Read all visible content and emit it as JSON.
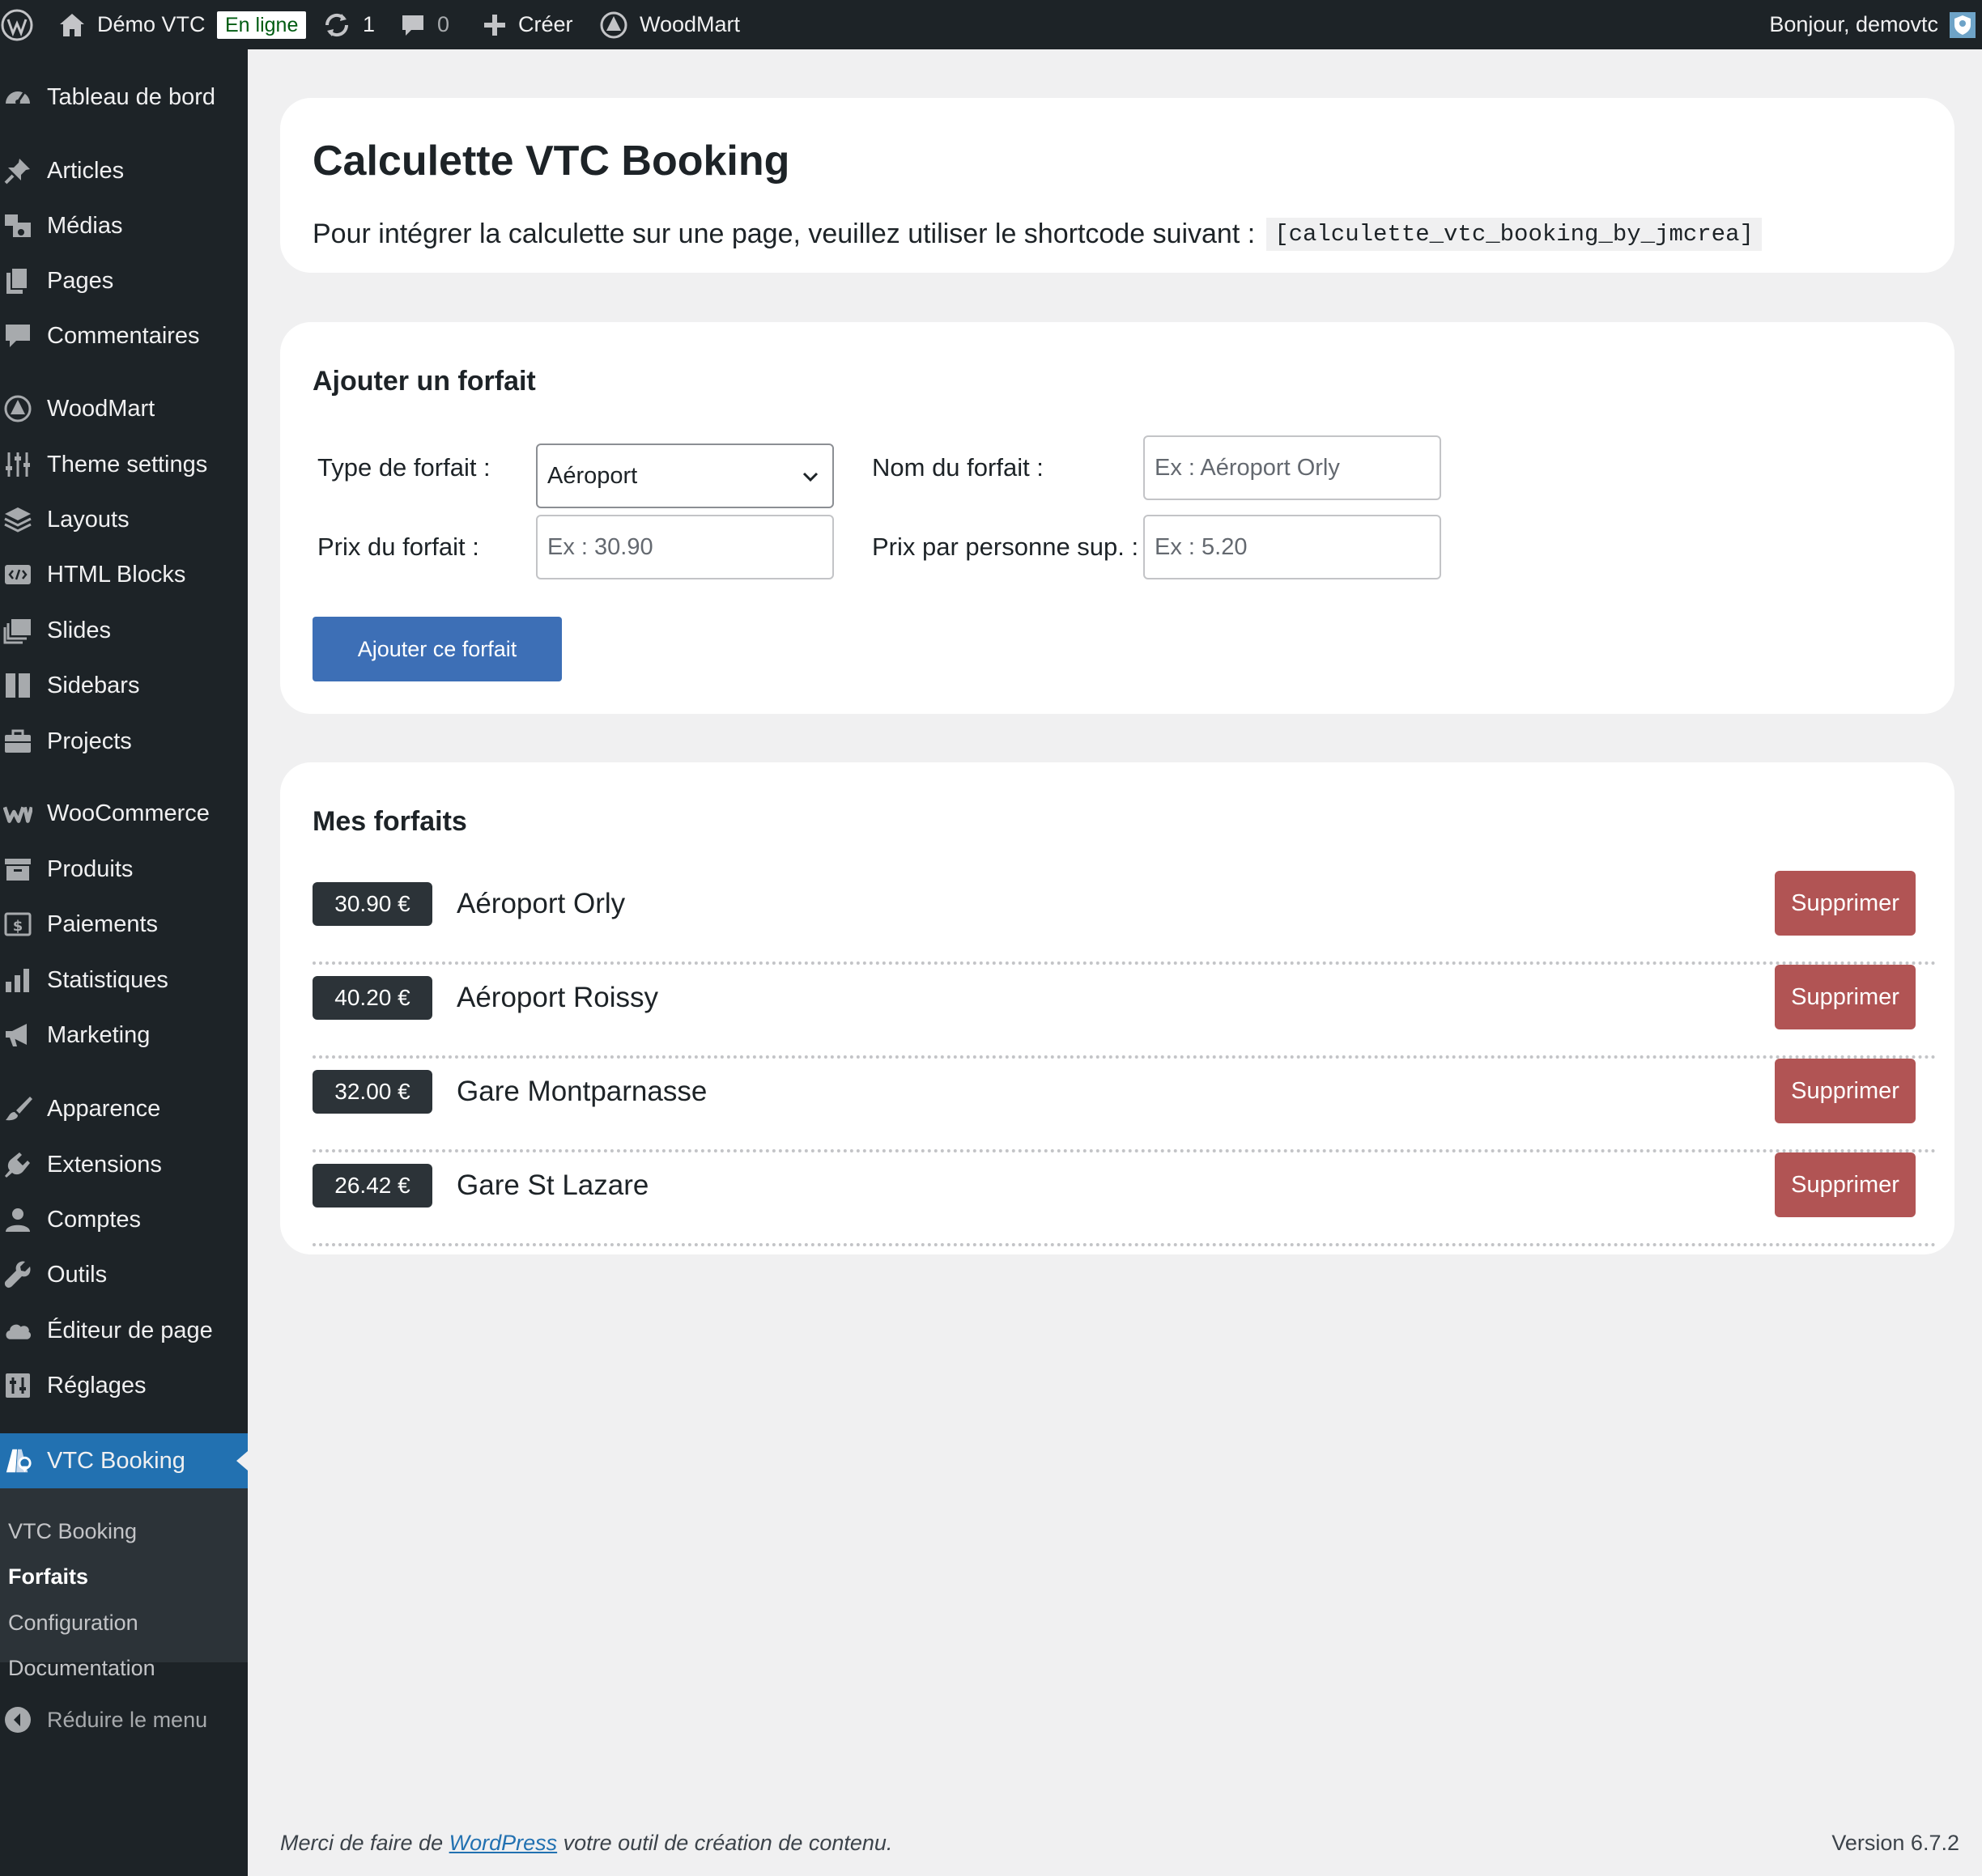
{
  "adminbar": {
    "site_name": "Démo VTC",
    "status_badge": "En ligne",
    "updates_count": "1",
    "comments_count": "0",
    "new_label": "Créer",
    "theme_label": "WoodMart",
    "greeting": "Bonjour, demovtc"
  },
  "sidebar": {
    "items": [
      {
        "label": "Tableau de bord",
        "icon": "dashboard-icon"
      },
      {
        "label": "Articles",
        "icon": "pin-icon"
      },
      {
        "label": "Médias",
        "icon": "media-icon"
      },
      {
        "label": "Pages",
        "icon": "pages-icon"
      },
      {
        "label": "Commentaires",
        "icon": "comments-icon"
      },
      {
        "label": "WoodMart",
        "icon": "woodmart-icon"
      },
      {
        "label": "Theme settings",
        "icon": "sliders-icon"
      },
      {
        "label": "Layouts",
        "icon": "layers-icon"
      },
      {
        "label": "HTML Blocks",
        "icon": "html-block-icon"
      },
      {
        "label": "Slides",
        "icon": "slides-icon"
      },
      {
        "label": "Sidebars",
        "icon": "sidebar-icon"
      },
      {
        "label": "Projects",
        "icon": "briefcase-icon"
      },
      {
        "label": "WooCommerce",
        "icon": "woocommerce-icon"
      },
      {
        "label": "Produits",
        "icon": "archive-icon"
      },
      {
        "label": "Paiements",
        "icon": "payment-icon"
      },
      {
        "label": "Statistiques",
        "icon": "chart-icon"
      },
      {
        "label": "Marketing",
        "icon": "megaphone-icon"
      },
      {
        "label": "Apparence",
        "icon": "brush-icon"
      },
      {
        "label": "Extensions",
        "icon": "plugin-icon"
      },
      {
        "label": "Comptes",
        "icon": "user-icon"
      },
      {
        "label": "Outils",
        "icon": "wrench-icon"
      },
      {
        "label": "Éditeur de page",
        "icon": "cloud-icon"
      },
      {
        "label": "Réglages",
        "icon": "settings-icon"
      },
      {
        "label": "VTC Booking",
        "icon": "vtc-booking-icon"
      }
    ],
    "submenu": [
      {
        "label": "VTC Booking"
      },
      {
        "label": "Forfaits"
      },
      {
        "label": "Configuration"
      },
      {
        "label": "Documentation"
      }
    ],
    "collapse_label": "Réduire le menu"
  },
  "header_card": {
    "title": "Calculette VTC Booking",
    "intro": "Pour intégrer la calculette sur une page, veuillez utiliser le shortcode suivant :",
    "shortcode": "[calculette_vtc_booking_by_jmcrea]"
  },
  "add_form": {
    "heading": "Ajouter un forfait",
    "type_label": "Type de forfait :",
    "type_value": "Aéroport",
    "name_label": "Nom du forfait :",
    "name_placeholder": "Ex : Aéroport Orly",
    "price_label": "Prix du forfait :",
    "price_placeholder": "Ex : 30.90",
    "extra_label": "Prix par personne sup. :",
    "extra_placeholder": "Ex : 5.20",
    "submit_label": "Ajouter ce forfait"
  },
  "forfaits": {
    "heading": "Mes forfaits",
    "delete_label": "Supprimer",
    "rows": [
      {
        "price": "30.90 €",
        "name": "Aéroport Orly"
      },
      {
        "price": "40.20 €",
        "name": "Aéroport Roissy"
      },
      {
        "price": "32.00 €",
        "name": "Gare Montparnasse"
      },
      {
        "price": "26.42 €",
        "name": "Gare St Lazare"
      }
    ]
  },
  "footer": {
    "text_before": "Merci de faire de",
    "link": "WordPress",
    "text_after": "votre outil de création de contenu.",
    "version": "Version 6.7.2"
  },
  "colors": {
    "admin_dark": "#1d2327",
    "accent_blue": "#2271b1",
    "button_blue": "#3d6fb6",
    "delete_red": "#b15454",
    "online_green": "#005c12"
  }
}
